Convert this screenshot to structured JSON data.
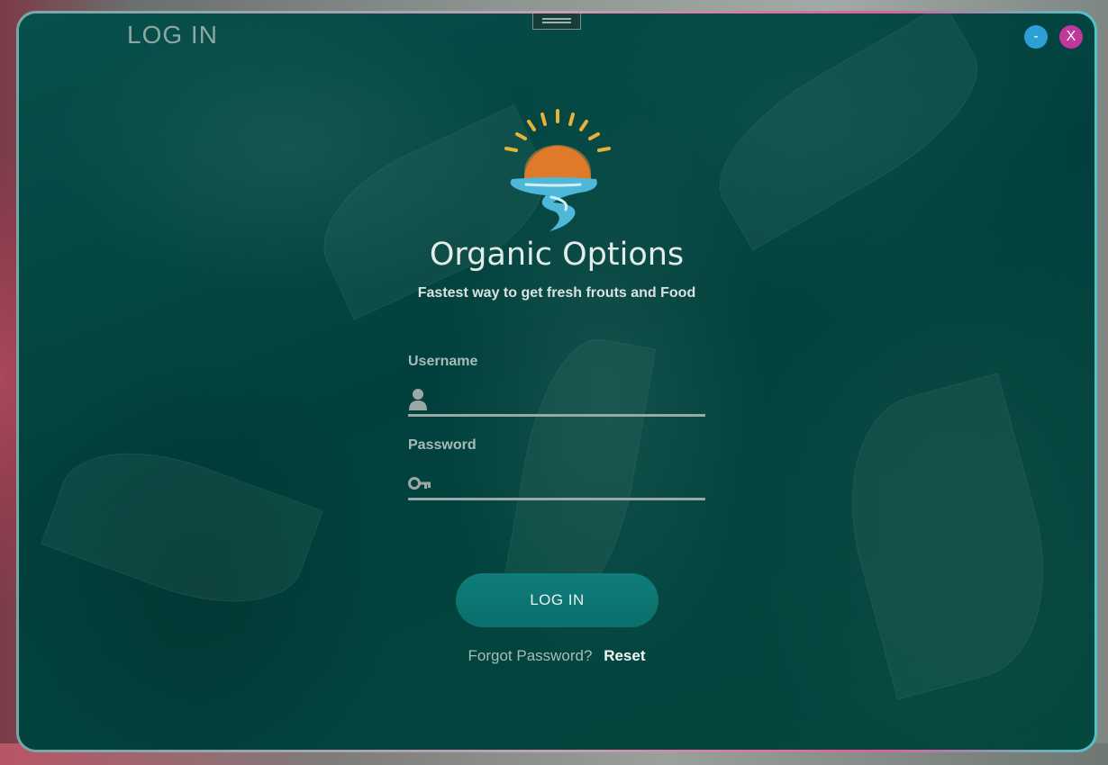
{
  "window": {
    "title": "LOG IN",
    "minimize_label": "-",
    "close_label": "X"
  },
  "brand": {
    "name": "Organic Options",
    "tagline": "Fastest way to get fresh frouts and Food",
    "logo_icon": "sun-over-river-logo"
  },
  "form": {
    "username": {
      "label": "Username",
      "value": "",
      "placeholder": "",
      "icon": "user-icon"
    },
    "password": {
      "label": "Password",
      "value": "",
      "placeholder": "",
      "icon": "key-icon"
    },
    "submit_label": "LOG IN",
    "forgot_text": "Forgot Password?",
    "reset_label": "Reset"
  },
  "colors": {
    "panel": "#03423f",
    "button": "#0a6f6c",
    "minimize": "#2b9fd6",
    "close": "#c0399a",
    "sun": "#e07a2a",
    "water": "#4fb8d8"
  }
}
